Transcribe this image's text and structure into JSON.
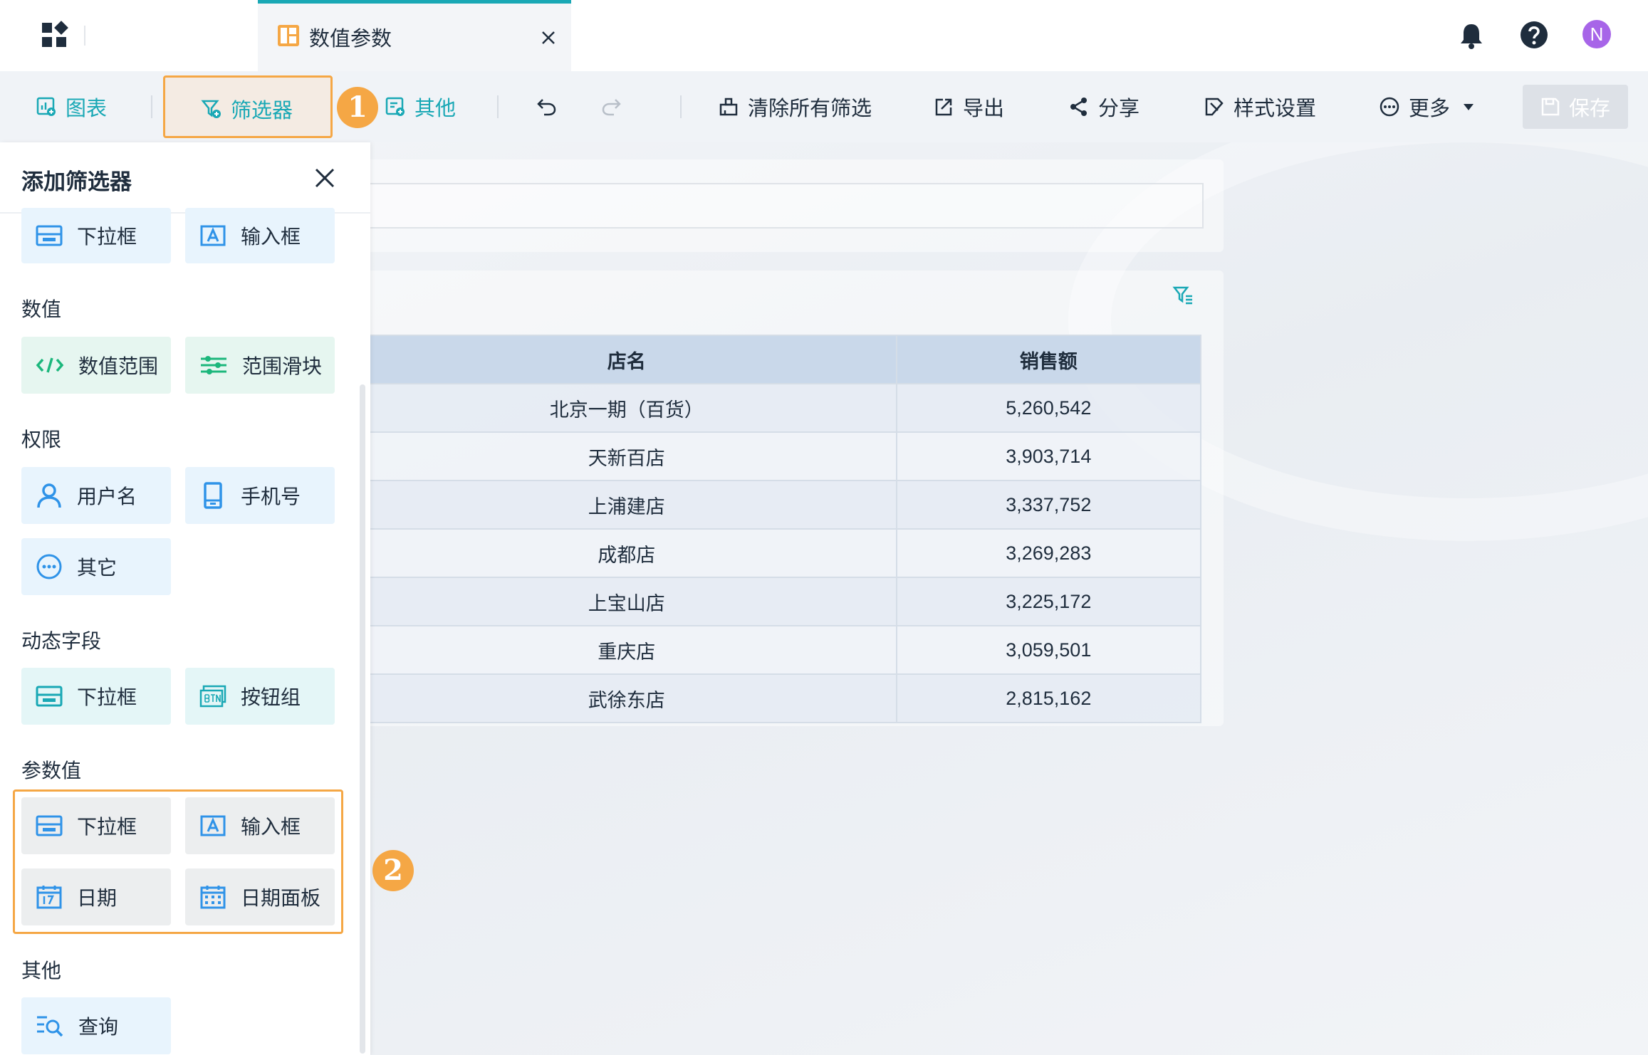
{
  "tab": {
    "title": "数值参数"
  },
  "user": {
    "avatar_letter": "N"
  },
  "toolbar": {
    "chart": "图表",
    "filter": "筛选器",
    "other": "其他",
    "clear_filters": "清除所有筛选",
    "export": "导出",
    "share": "分享",
    "style": "样式设置",
    "more": "更多",
    "save": "保存"
  },
  "badges": {
    "one": "1",
    "two": "2"
  },
  "panel": {
    "title": "添加筛选器",
    "top_items": [
      "下拉框",
      "输入框"
    ],
    "sections": {
      "numeric": {
        "label": "数值",
        "items": [
          "数值范围",
          "范围滑块"
        ]
      },
      "permission": {
        "label": "权限",
        "items": [
          "用户名",
          "手机号",
          "其它"
        ]
      },
      "dynamic": {
        "label": "动态字段",
        "items": [
          "下拉框",
          "按钮组"
        ]
      },
      "param": {
        "label": "参数值",
        "items": [
          "下拉框",
          "输入框",
          "日期",
          "日期面板"
        ]
      },
      "other": {
        "label": "其他",
        "items": [
          "查询"
        ]
      }
    }
  },
  "table": {
    "headers": [
      "店名",
      "销售额"
    ],
    "rows": [
      [
        "北京一期（百货）",
        "5,260,542"
      ],
      [
        "天新百店",
        "3,903,714"
      ],
      [
        "上浦建店",
        "3,337,752"
      ],
      [
        "成都店",
        "3,269,283"
      ],
      [
        "上宝山店",
        "3,225,172"
      ],
      [
        "重庆店",
        "3,059,501"
      ],
      [
        "武徐东店",
        "2,815,162"
      ]
    ]
  },
  "colors": {
    "accent": "#19a8b5",
    "highlight": "#f5a745",
    "avatar": "#a765e8"
  }
}
